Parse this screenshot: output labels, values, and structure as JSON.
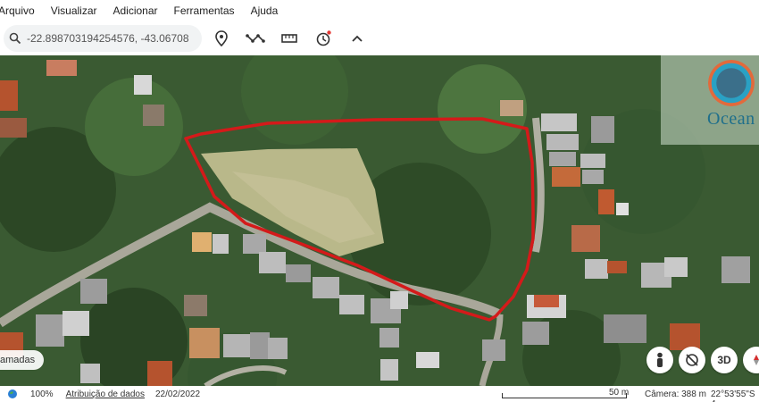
{
  "menu": {
    "items": [
      "Arquivo",
      "Visualizar",
      "Adicionar",
      "Ferramentas",
      "Ajuda"
    ]
  },
  "search": {
    "value": "-22.898703194254576, -43.06708"
  },
  "toolbar": {
    "icons": [
      "placemark-icon",
      "path-icon",
      "ruler-icon",
      "history-icon",
      "collapse-icon"
    ]
  },
  "overlay": {
    "logo_text": "Ocean"
  },
  "map_controls": {
    "layers_label": "amadas",
    "three_d_label": "3D"
  },
  "statusbar": {
    "zoom": "100%",
    "attribution": "Atribuição de dados",
    "date": "22/02/2022",
    "scale": "50 m",
    "camera": "Câmera: 388 m",
    "coords": "22°53'55\"S 4"
  },
  "colors": {
    "outline": "#d41a1a",
    "vegetation": "#3f6b35",
    "clearing": "#b9b88a"
  }
}
